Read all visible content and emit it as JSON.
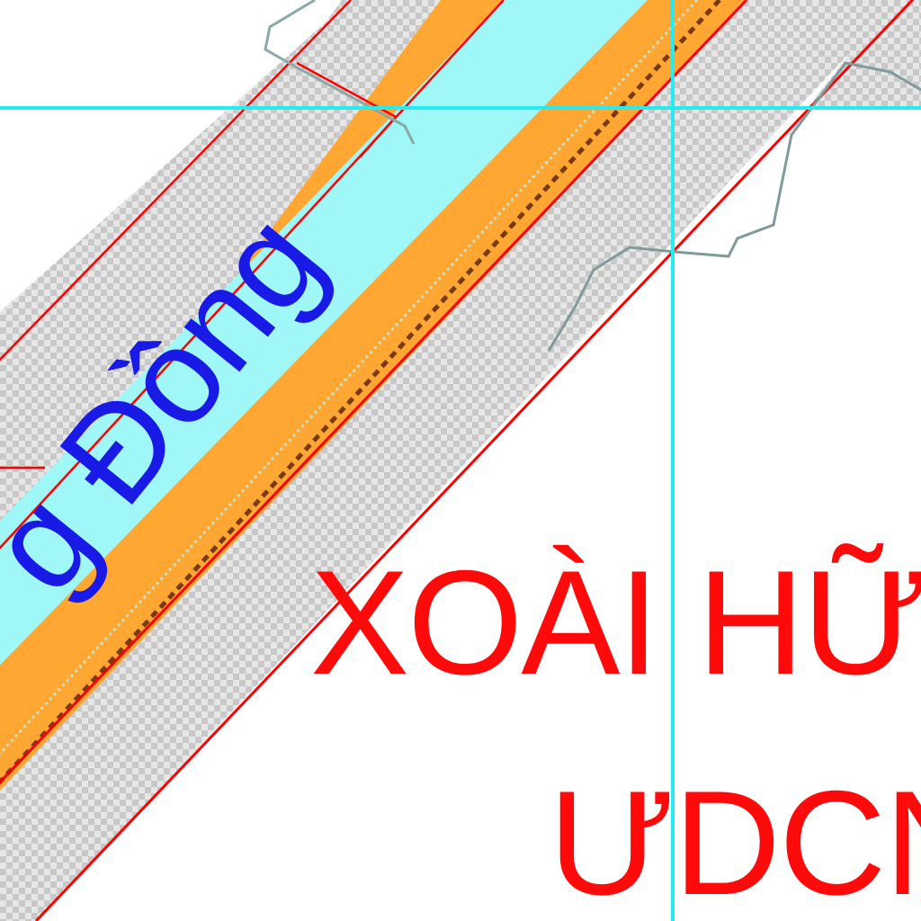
{
  "map": {
    "labels": {
      "river": "g Đồng",
      "zone_line_1": "XOÀI HỮ",
      "zone_line_2": "ƯDCN"
    },
    "colors": {
      "background": "#ffffff",
      "hatch_light": "#e6e6e6",
      "hatch_dark": "#c8c8c8",
      "boundary_red": "#ff0000",
      "river_water": "#9ff7f7",
      "river_bank": "#ffa633",
      "channel_brown": "#7a3a10",
      "grid_cyan": "#24ecf0",
      "contour_grey": "#7f9a9a",
      "river_label": "#1a1ae6",
      "zone_label": "#ff0a0a"
    },
    "icons": [
      "checker-hatch-pattern"
    ]
  }
}
